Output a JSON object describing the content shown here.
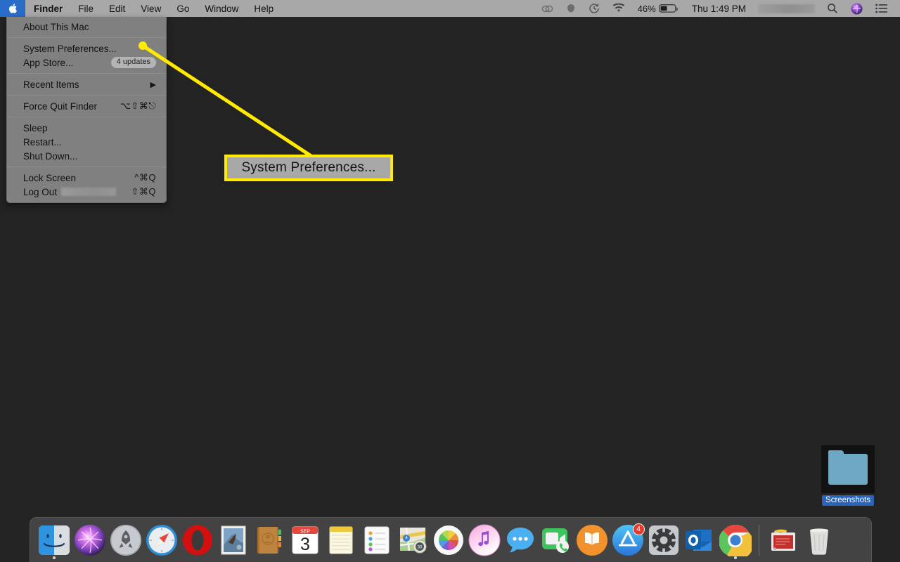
{
  "menubar": {
    "apple_icon": "apple-logo-icon",
    "app_name": "Finder",
    "items": [
      "File",
      "Edit",
      "View",
      "Go",
      "Window",
      "Help"
    ],
    "status": {
      "creative_cloud_icon": "creative-cloud-icon",
      "dropbox_icon": "dropbox-icon",
      "time_machine_icon": "time-machine-icon",
      "wifi_icon": "wifi-icon",
      "battery_percent": "46%",
      "battery_icon": "battery-icon",
      "clock": "Thu 1:49 PM",
      "username_blurred": "",
      "search_icon": "search-icon",
      "siri_icon": "siri-icon",
      "control_center_icon": "control-center-icon"
    }
  },
  "apple_menu": {
    "items": [
      {
        "label": "About This Mac",
        "type": "item"
      },
      {
        "type": "separator"
      },
      {
        "label": "System Preferences...",
        "type": "item"
      },
      {
        "label": "App Store...",
        "type": "item",
        "badge": "4 updates"
      },
      {
        "type": "separator"
      },
      {
        "label": "Recent Items",
        "type": "submenu",
        "arrow": "▶"
      },
      {
        "type": "separator"
      },
      {
        "label": "Force Quit Finder",
        "type": "item",
        "shortcut": "⌥⇧⌘⎋"
      },
      {
        "type": "separator"
      },
      {
        "label": "Sleep",
        "type": "item"
      },
      {
        "label": "Restart...",
        "type": "item"
      },
      {
        "label": "Shut Down...",
        "type": "item"
      },
      {
        "type": "separator"
      },
      {
        "label": "Lock Screen",
        "type": "item",
        "shortcut": "^⌘Q"
      },
      {
        "label": "Log Out",
        "type": "item",
        "shortcut": "⇧⌘Q",
        "blurred_name": true
      }
    ],
    "labels": {
      "about_this_mac": "About This Mac",
      "system_preferences": "System Preferences...",
      "app_store": "App Store...",
      "app_store_badge": "4 updates",
      "recent_items": "Recent Items",
      "recent_items_arrow": "▶",
      "force_quit": "Force Quit Finder",
      "force_quit_shortcut": "⌥⇧⌘⎋",
      "sleep": "Sleep",
      "restart": "Restart...",
      "shut_down": "Shut Down...",
      "lock_screen": "Lock Screen",
      "lock_screen_shortcut": "^⌘Q",
      "log_out": "Log Out",
      "log_out_shortcut": "⇧⌘Q"
    }
  },
  "callout": {
    "text": "System Preferences...",
    "border_color": "#ffea00",
    "fill_color": "#a8a8a8",
    "line_color": "#ffea00"
  },
  "desktop": {
    "background_color": "#232323",
    "icon": {
      "name": "Screenshots",
      "type": "folder",
      "selected": true,
      "label_highlight_color": "#2a63b8"
    }
  },
  "dock": {
    "items": [
      {
        "name": "Finder",
        "icon": "finder-icon",
        "running": true
      },
      {
        "name": "Siri",
        "icon": "siri-icon",
        "running": false
      },
      {
        "name": "Launchpad",
        "icon": "launchpad-icon",
        "running": false
      },
      {
        "name": "Safari",
        "icon": "safari-icon",
        "running": false
      },
      {
        "name": "Opera",
        "icon": "opera-icon",
        "running": false
      },
      {
        "name": "Mail",
        "icon": "mail-icon",
        "running": false
      },
      {
        "name": "Contacts",
        "icon": "contacts-icon",
        "running": false
      },
      {
        "name": "Calendar",
        "icon": "calendar-icon",
        "running": false,
        "month": "SEP",
        "day": "3"
      },
      {
        "name": "Notes",
        "icon": "notes-icon",
        "running": false
      },
      {
        "name": "Reminders",
        "icon": "reminders-icon",
        "running": false
      },
      {
        "name": "Maps",
        "icon": "maps-icon",
        "running": false
      },
      {
        "name": "Photos",
        "icon": "photos-icon",
        "running": false
      },
      {
        "name": "iTunes",
        "icon": "itunes-icon",
        "running": false
      },
      {
        "name": "Messages",
        "icon": "messages-icon",
        "running": false
      },
      {
        "name": "FaceTime",
        "icon": "facetime-icon",
        "running": false
      },
      {
        "name": "Books",
        "icon": "books-icon",
        "running": false
      },
      {
        "name": "App Store",
        "icon": "app-store-icon",
        "running": false,
        "badge": "4"
      },
      {
        "name": "System Preferences",
        "icon": "system-preferences-icon",
        "running": false
      },
      {
        "name": "Outlook",
        "icon": "outlook-icon",
        "running": false
      },
      {
        "name": "Google Chrome",
        "icon": "chrome-icon",
        "running": true
      },
      {
        "name": "Downloads",
        "icon": "downloads-stack-icon",
        "running": false
      },
      {
        "name": "Trash",
        "icon": "trash-icon",
        "running": false
      }
    ]
  }
}
